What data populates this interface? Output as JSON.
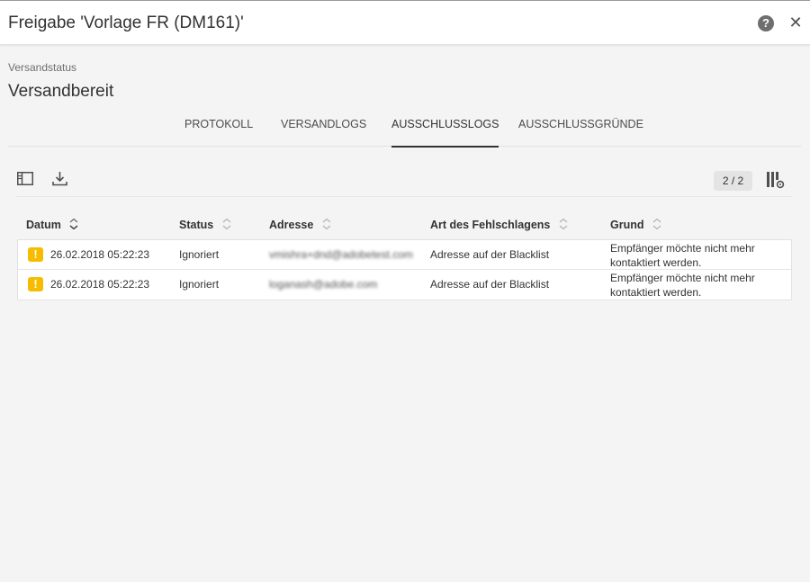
{
  "window": {
    "title": "Freigabe 'Vorlage FR (DM161)'",
    "help_icon": "?",
    "close_icon": "✕"
  },
  "status": {
    "label": "Versandstatus",
    "value": "Versandbereit"
  },
  "tabs": [
    {
      "label": "PROTOKOLL",
      "active": false
    },
    {
      "label": "VERSANDLOGS",
      "active": false
    },
    {
      "label": "AUSSCHLUSSLOGS",
      "active": true
    },
    {
      "label": "AUSSCHLUSSGRÜNDE",
      "active": false
    }
  ],
  "toolbar": {
    "panel_icon": "panel-toggle-icon",
    "download_icon": "download-icon",
    "pager": "2 / 2",
    "columns_icon": "column-settings-icon"
  },
  "table": {
    "columns": [
      "Datum",
      "Status",
      "Adresse",
      "Art des Fehlschlagens",
      "Grund"
    ],
    "rows": [
      {
        "warning": "!",
        "date": "26.02.2018 05:22:23",
        "status": "Ignoriert",
        "address": "vmishra+dnd@adobetest.com",
        "failure_type": "Adresse auf der Blacklist",
        "reason": "Empfänger möchte nicht mehr kontaktiert werden."
      },
      {
        "warning": "!",
        "date": "26.02.2018 05:22:23",
        "status": "Ignoriert",
        "address": "loganash@adobe.com",
        "failure_type": "Adresse auf der Blacklist",
        "reason": "Empfänger möchte nicht mehr kontaktiert werden."
      }
    ]
  },
  "colors": {
    "warning": "#f6bc00",
    "background": "#f4f4f4",
    "active_tab_underline": "#323232"
  }
}
